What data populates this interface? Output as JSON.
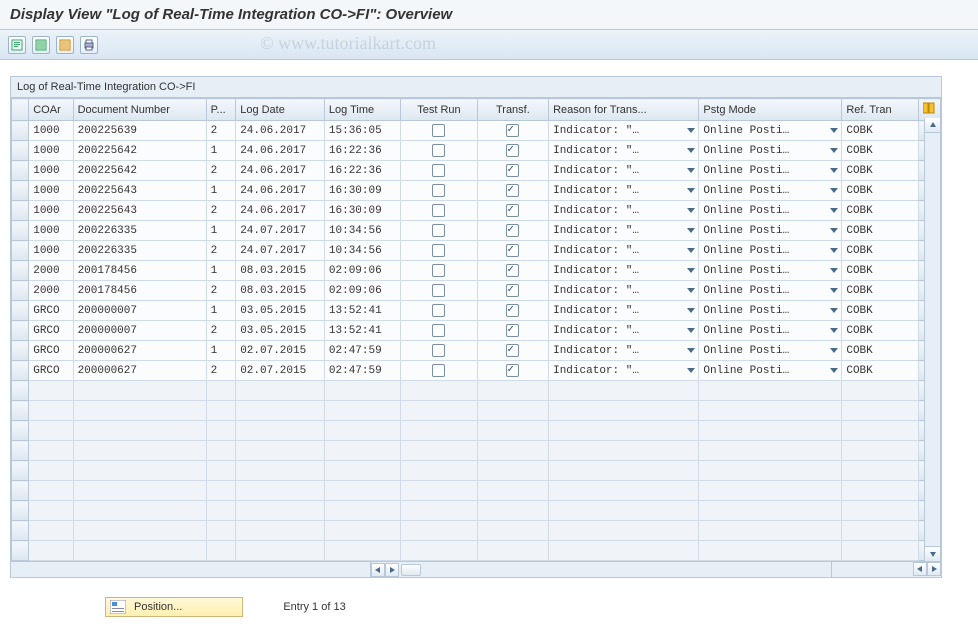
{
  "page_title": "Display View \"Log of Real-Time Integration CO->FI\": Overview",
  "watermark": "© www.tutorialkart.com",
  "grid_title": "Log of Real-Time Integration CO->FI",
  "columns": {
    "coar": "COAr",
    "docnum": "Document Number",
    "p": "P...",
    "logdate": "Log Date",
    "logtime": "Log Time",
    "testrun": "Test Run",
    "transf": "Transf.",
    "reason": "Reason for Trans...",
    "pstgmode": "Pstg Mode",
    "reftran": "Ref. Tran"
  },
  "reason_value": "Indicator: \"…",
  "pstg_value": "Online Posti…",
  "ref_value": "COBK",
  "rows": [
    {
      "coar": "1000",
      "docnum": "200225639",
      "p": "2",
      "logdate": "24.06.2017",
      "logtime": "15:36:05"
    },
    {
      "coar": "1000",
      "docnum": "200225642",
      "p": "1",
      "logdate": "24.06.2017",
      "logtime": "16:22:36"
    },
    {
      "coar": "1000",
      "docnum": "200225642",
      "p": "2",
      "logdate": "24.06.2017",
      "logtime": "16:22:36"
    },
    {
      "coar": "1000",
      "docnum": "200225643",
      "p": "1",
      "logdate": "24.06.2017",
      "logtime": "16:30:09"
    },
    {
      "coar": "1000",
      "docnum": "200225643",
      "p": "2",
      "logdate": "24.06.2017",
      "logtime": "16:30:09"
    },
    {
      "coar": "1000",
      "docnum": "200226335",
      "p": "1",
      "logdate": "24.07.2017",
      "logtime": "10:34:56"
    },
    {
      "coar": "1000",
      "docnum": "200226335",
      "p": "2",
      "logdate": "24.07.2017",
      "logtime": "10:34:56"
    },
    {
      "coar": "2000",
      "docnum": "200178456",
      "p": "1",
      "logdate": "08.03.2015",
      "logtime": "02:09:06"
    },
    {
      "coar": "2000",
      "docnum": "200178456",
      "p": "2",
      "logdate": "08.03.2015",
      "logtime": "02:09:06"
    },
    {
      "coar": "GRCO",
      "docnum": "200000007",
      "p": "1",
      "logdate": "03.05.2015",
      "logtime": "13:52:41"
    },
    {
      "coar": "GRCO",
      "docnum": "200000007",
      "p": "2",
      "logdate": "03.05.2015",
      "logtime": "13:52:41"
    },
    {
      "coar": "GRCO",
      "docnum": "200000627",
      "p": "1",
      "logdate": "02.07.2015",
      "logtime": "02:47:59"
    },
    {
      "coar": "GRCO",
      "docnum": "200000627",
      "p": "2",
      "logdate": "02.07.2015",
      "logtime": "02:47:59"
    }
  ],
  "empty_rows": 9,
  "footer": {
    "position_label": "Position...",
    "entry_info": "Entry 1 of 13"
  }
}
